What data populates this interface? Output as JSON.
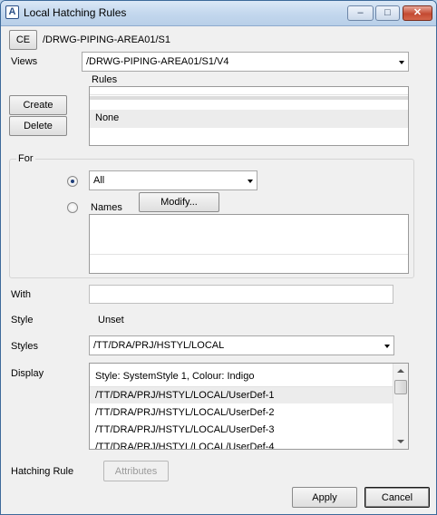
{
  "window": {
    "title": "Local Hatching Rules",
    "icon": "app-icon",
    "controls": {
      "minimize": "minimize-icon",
      "maximize": "maximize-icon",
      "close": "close-icon"
    }
  },
  "header": {
    "ce_label": "CE",
    "path": "/DRWG-PIPING-AREA01/S1"
  },
  "views": {
    "label": "Views",
    "selected": "/DRWG-PIPING-AREA01/S1/V4"
  },
  "rules": {
    "label": "Rules",
    "items": [
      "None"
    ],
    "create_label": "Create",
    "delete_label": "Delete"
  },
  "for_group": {
    "label": "For",
    "all_selected": "All",
    "names_label": "Names",
    "modify_label": "Modify..."
  },
  "with": {
    "label": "With",
    "value": ""
  },
  "style": {
    "label": "Style",
    "value": "Unset"
  },
  "styles": {
    "label": "Styles",
    "selected": "/TT/DRA/PRJ/HSTYL/LOCAL"
  },
  "display": {
    "label": "Display",
    "header": "Style: SystemStyle 1, Colour: Indigo",
    "items": [
      "/TT/DRA/PRJ/HSTYL/LOCAL/UserDef-1",
      "/TT/DRA/PRJ/HSTYL/LOCAL/UserDef-2",
      "/TT/DRA/PRJ/HSTYL/LOCAL/UserDef-3",
      "/TT/DRA/PRJ/HSTYL/LOCAL/UserDef-4"
    ]
  },
  "hatching_rule": {
    "label": "Hatching Rule",
    "attributes_label": "Attributes"
  },
  "footer": {
    "apply_label": "Apply",
    "cancel_label": "Cancel"
  }
}
